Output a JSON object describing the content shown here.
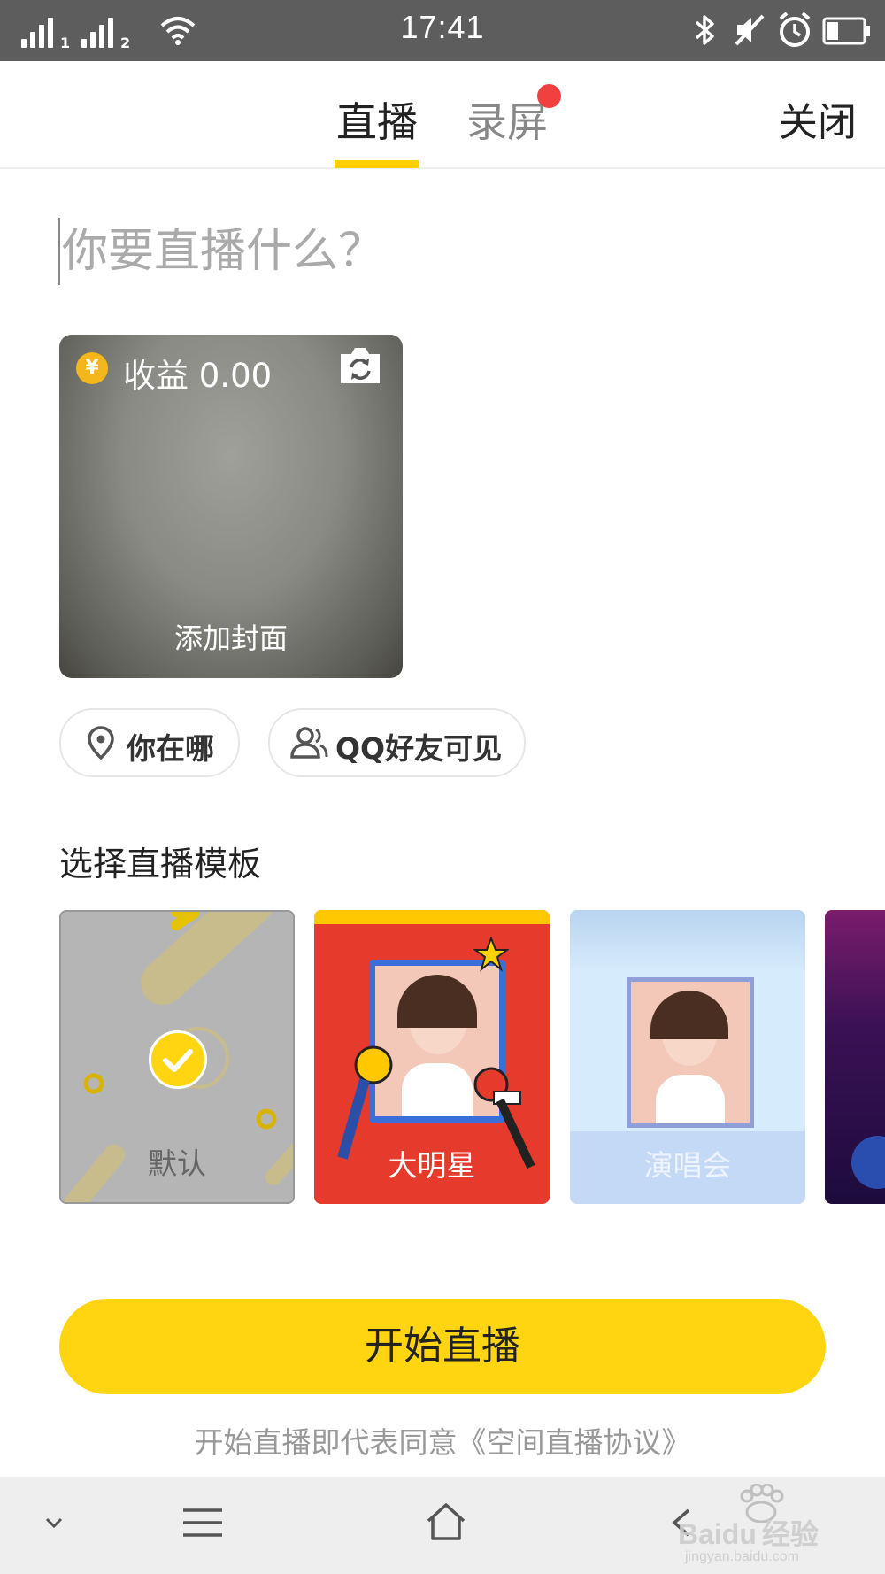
{
  "status_bar": {
    "time": "17:41",
    "sim1_label": "1",
    "sim2_label": "2",
    "icons": [
      "signal-icon",
      "wifi-icon",
      "bluetooth-icon",
      "mute-icon",
      "alarm-icon",
      "battery-icon"
    ]
  },
  "tabs": {
    "live_label": "直播",
    "record_label": "录屏",
    "close_label": "关闭"
  },
  "title_input": {
    "placeholder": "你要直播什么？"
  },
  "cover": {
    "earnings_label": "收益 0.00",
    "coin_symbol": "¥",
    "add_cover_label": "添加封面"
  },
  "chips": {
    "location_label": "你在哪",
    "visibility_label": "QQ好友可见"
  },
  "templates": {
    "section_title": "选择直播模板",
    "items": [
      {
        "label": "默认",
        "selected": true
      },
      {
        "label": "大明星",
        "selected": false
      },
      {
        "label": "演唱会",
        "selected": false
      },
      {
        "label": "",
        "selected": false
      }
    ]
  },
  "actions": {
    "start_label": "开始直播",
    "agreement_text": "开始直播即代表同意《空间直播协议》"
  },
  "colors": {
    "accent": "#ffd512",
    "tab_underline": "#ffd000",
    "badge": "#f04040"
  },
  "navbar": {
    "icons": [
      "chevron-down-icon",
      "menu-icon",
      "home-icon",
      "back-icon"
    ]
  },
  "watermark": {
    "brand": "Baidu",
    "brand_cn": "经验",
    "url": "jingyan.baidu.com"
  }
}
